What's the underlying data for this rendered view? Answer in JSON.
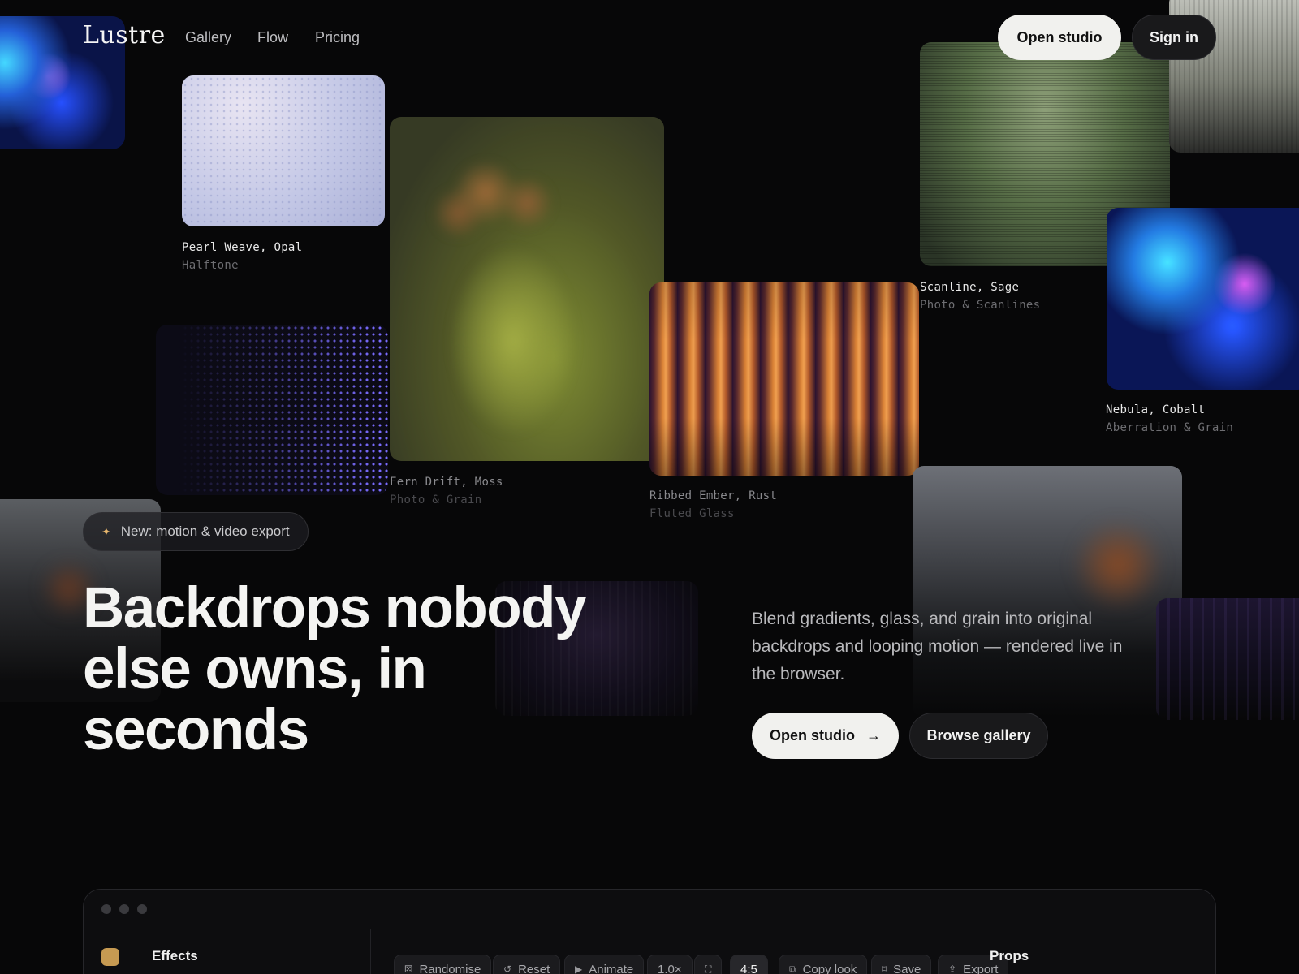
{
  "brand": {
    "logo": "Lustre"
  },
  "nav": {
    "links": [
      "Gallery",
      "Flow",
      "Pricing"
    ],
    "open_studio": "Open studio",
    "sign_in": "Sign in"
  },
  "gallery": [
    {
      "title": "Pearl Weave, Opal",
      "subtitle": "Halftone"
    },
    {
      "title": "Fern Drift, Moss",
      "subtitle": "Photo & Grain"
    },
    {
      "title": "Ribbed Ember, Rust",
      "subtitle": "Fluted Glass"
    },
    {
      "title": "Scanline, Sage",
      "subtitle": "Photo & Scanlines"
    },
    {
      "title": "Nebula, Cobalt",
      "subtitle": "Aberration & Grain"
    }
  ],
  "hero": {
    "badge_icon": "sparkle-icon",
    "badge": "New: motion & video export",
    "headline": "Backdrops nobody else owns, in seconds",
    "lede": "Blend gradients, glass, and grain into original backdrops and looping motion — rendered live in the browser.",
    "cta_primary": "Open studio",
    "cta_primary_icon": "arrow-right-icon",
    "cta_secondary": "Browse gallery"
  },
  "app": {
    "effects_label": "Effects",
    "props_label": "Props",
    "toolbar": {
      "randomise": "Randomise",
      "reset": "Reset",
      "animate": "Animate",
      "speed": "1.0×",
      "ratio": "4:5",
      "copy_look": "Copy look",
      "save": "Save",
      "export": "Export"
    }
  },
  "colors": {
    "background": "#070708",
    "accent_swatch": "#c69a52",
    "button_light": "#f1f1ee"
  }
}
